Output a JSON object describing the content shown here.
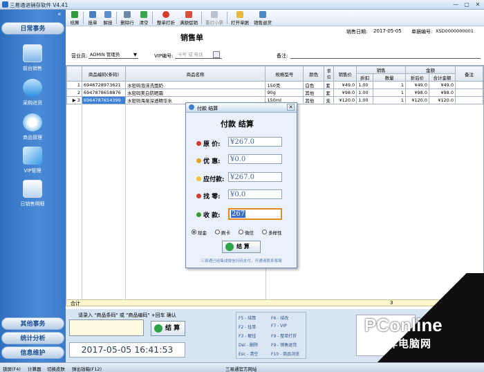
{
  "window": {
    "title": "三易通进销存软件 V4.41",
    "min": "—",
    "max": "▢",
    "close": "✕"
  },
  "sidebar": {
    "collapse": "«",
    "header": "日常事务",
    "items": [
      {
        "label": "前台销售"
      },
      {
        "label": "采购进货"
      },
      {
        "label": "商品管理"
      },
      {
        "label": "VIP管理"
      },
      {
        "label": "日销售明细"
      }
    ],
    "bottom_headers": [
      "其他事务",
      "统计分析",
      "信息维护"
    ]
  },
  "toolbar": {
    "items": [
      "结算",
      "挂单",
      "解挂",
      "删除行",
      "清空",
      "整单打折",
      "满额促销",
      "重打小票",
      "打开单据",
      "销售退货"
    ]
  },
  "form": {
    "title": "销售单",
    "date_label": "销售日期:",
    "date_value": "2017-05-05",
    "docno_label": "单据编号:",
    "docno_value": "XSD0000000001",
    "clerk_label": "营业员:",
    "clerk_value": "ADMIN 管理员",
    "vip_label": "VIP编号:",
    "vip_placeholder": "卡号 或 电话",
    "note_label": "备注:"
  },
  "grid": {
    "headers": [
      "商品编码(条码)",
      "商品名称",
      "规格型号",
      "颜色",
      "单位",
      "销售价",
      "折扣",
      "数量",
      "折后价",
      "合计金额",
      "备注"
    ],
    "group_sales": "销售",
    "group_amount": "金额",
    "rows": [
      {
        "no": "1",
        "code": "6946728973621",
        "name": "水密码泡沫洗面奶",
        "spec": "150克",
        "color": "白色",
        "unit": "套",
        "price": "¥49.0",
        "disc": "1.00",
        "qty": "1",
        "after": "¥49.0",
        "total": "¥49.0"
      },
      {
        "no": "2",
        "code": "6947878658876",
        "name": "水密码美白防晒霜",
        "spec": "90g",
        "color": "其他",
        "unit": "套",
        "price": "¥98.0",
        "disc": "1.00",
        "qty": "1",
        "after": "¥98.0",
        "total": "¥98.0"
      },
      {
        "no": "3",
        "code": "6964787654399",
        "name": "水密码海泉深透精华水",
        "spec": "150ml",
        "color": "其他",
        "unit": "支",
        "price": "¥120.0",
        "disc": "1.00",
        "qty": "1",
        "after": "¥120.0",
        "total": "¥120.0"
      }
    ],
    "sum_label": "合计",
    "sum_value": "3"
  },
  "dialog": {
    "title": "付款 结算",
    "heading": "付款 结算",
    "fields": [
      {
        "label": "原  价:",
        "value": "¥267.0"
      },
      {
        "label": "优  惠:",
        "value": "¥0.0"
      },
      {
        "label": "应付款:",
        "value": "¥267.0"
      },
      {
        "label": "找  零:",
        "value": "¥0.0"
      },
      {
        "label": "收  款:",
        "value": "267"
      }
    ],
    "payment_methods": [
      "现金",
      "刷卡",
      "微信",
      "多样性"
    ],
    "button": "结 算",
    "footer": "三易通已经集成微信扫码支付，开通请联系客服"
  },
  "bottom": {
    "prompt": "请录入 \"商品条码\" 或 \"商品编码\" +回车 确认",
    "checkout": "结 算",
    "clock": "2017-05-05 16:41:53",
    "shortcuts": [
      [
        "F5 - 结算",
        "F6 - 结改"
      ],
      [
        "F2 - 挂单",
        "F7 - VIP"
      ],
      [
        "F3 - 解挂",
        "F9 - 整单打折"
      ],
      [
        "Del - 删除",
        "F9 - 销售退货"
      ],
      [
        "Esc - 清空",
        "F10 - 商品浏览"
      ]
    ]
  },
  "status": {
    "items": [
      "锁屏(F4)",
      "计算器",
      "切换皮肤",
      "弹出钱箱(F12)"
    ],
    "center": "三易通官方网站"
  },
  "watermark": {
    "brand": "PConline",
    "sub": "太平洋电脑网"
  },
  "colors": {
    "accent": "#3c80d8",
    "sidebar": "#3a7acb"
  }
}
